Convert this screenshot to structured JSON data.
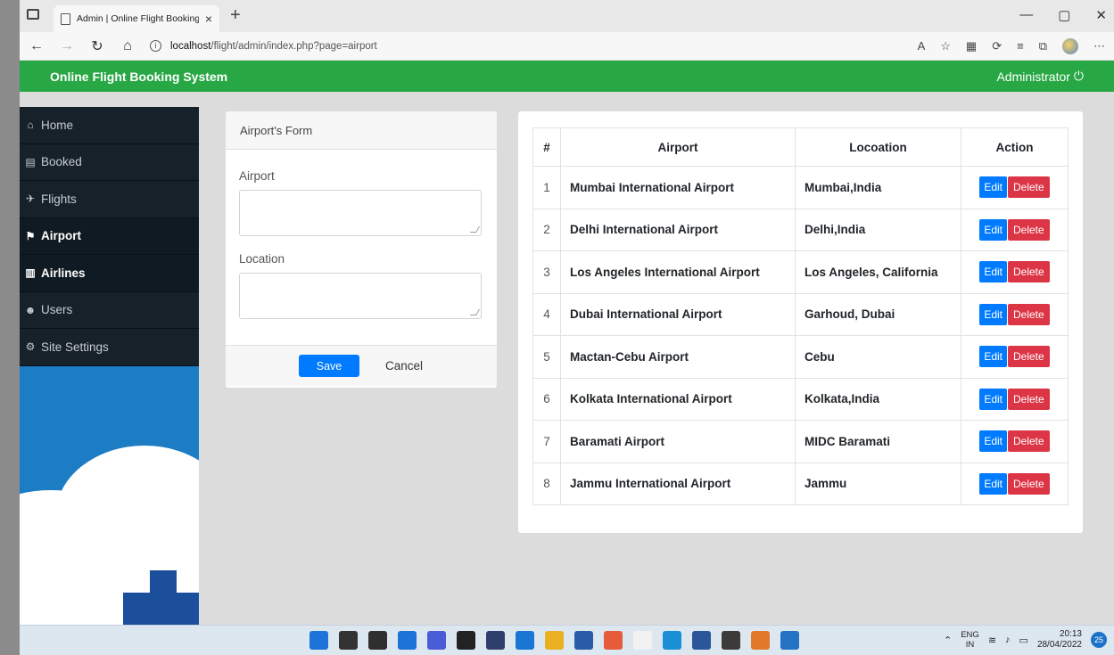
{
  "browser": {
    "tab_title": "Admin | Online Flight Booking Sy",
    "tab_close": "×",
    "new_tab": "+",
    "url_host": "localhost",
    "url_path": "/flight/admin/index.php?page=airport",
    "min": "—",
    "max": "▢",
    "close": "✕"
  },
  "app": {
    "brand": "Online Flight Booking System",
    "user": "Administrator"
  },
  "sidebar": {
    "items": [
      {
        "label": "Home",
        "icon": "home-icon",
        "glyph": "⌂"
      },
      {
        "label": "Booked",
        "icon": "booked-icon",
        "glyph": "▤"
      },
      {
        "label": "Flights",
        "icon": "plane-icon",
        "glyph": "✈"
      },
      {
        "label": "Airport",
        "icon": "airport-icon",
        "glyph": "⚑"
      },
      {
        "label": "Airlines",
        "icon": "airlines-icon",
        "glyph": "▥"
      },
      {
        "label": "Users",
        "icon": "users-icon",
        "glyph": "☻"
      },
      {
        "label": "Site Settings",
        "icon": "gear-icon",
        "glyph": "⚙"
      }
    ]
  },
  "form": {
    "title": "Airport's Form",
    "airport_label": "Airport",
    "location_label": "Location",
    "save": "Save",
    "cancel": "Cancel"
  },
  "table": {
    "headers": [
      "#",
      "Airport",
      "Locoation",
      "Action"
    ],
    "rows": [
      {
        "num": "1",
        "airport": "Mumbai International Airport",
        "location": "Mumbai,India"
      },
      {
        "num": "2",
        "airport": "Delhi International Airport",
        "location": "Delhi,India"
      },
      {
        "num": "3",
        "airport": "Los Angeles International Airport",
        "location": "Los Angeles, California"
      },
      {
        "num": "4",
        "airport": "Dubai International Airport",
        "location": "Garhoud, Dubai"
      },
      {
        "num": "5",
        "airport": "Mactan-Cebu Airport",
        "location": "Cebu"
      },
      {
        "num": "6",
        "airport": "Kolkata International Airport",
        "location": "Kolkata,India"
      },
      {
        "num": "7",
        "airport": "Baramati Airport",
        "location": "MIDC Baramati"
      },
      {
        "num": "8",
        "airport": "Jammu International Airport",
        "location": "Jammu"
      }
    ],
    "edit": "Edit",
    "delete": "Delete"
  },
  "taskbar": {
    "lang_top": "ENG",
    "lang_bottom": "IN",
    "time": "20:13",
    "date": "28/04/2022",
    "notifications": "25",
    "apps": [
      "#1e73d8",
      "#333333",
      "#2f2f2f",
      "#1e73d8",
      "#4a5cd6",
      "#222222",
      "#2e3f6e",
      "#1976d2",
      "#e8b022",
      "#2a5da8",
      "#e65c3a",
      "#f2f2f2",
      "#1a8fd6",
      "#2b579a",
      "#3b3b3b",
      "#e07a2a",
      "#2372c4"
    ]
  }
}
